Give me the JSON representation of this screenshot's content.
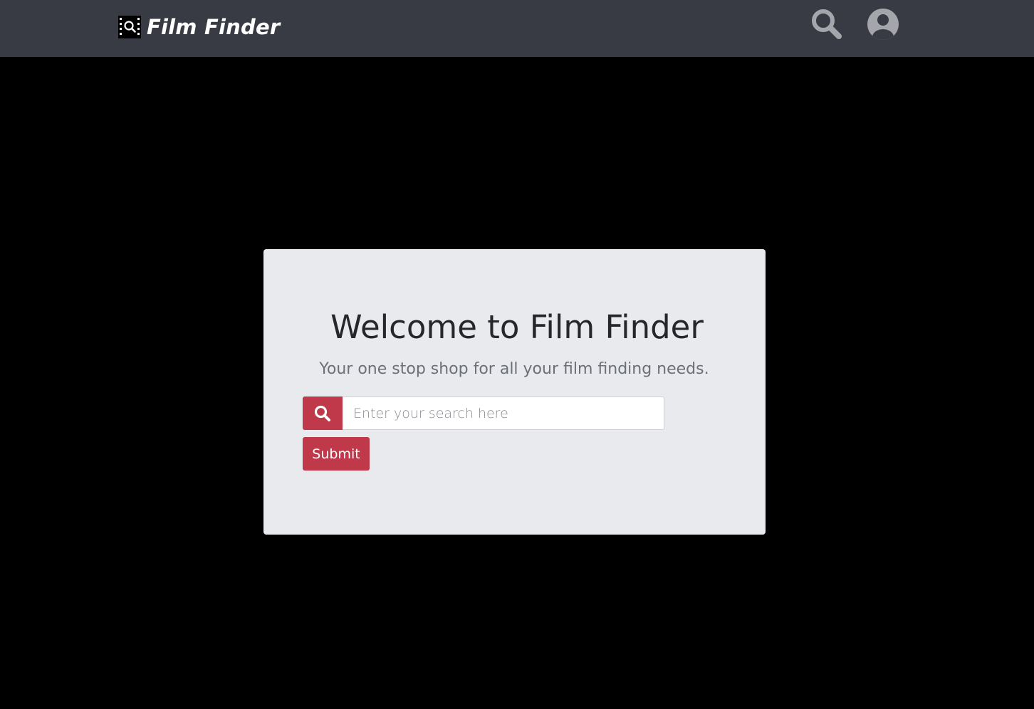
{
  "navbar": {
    "brand_text": "Film Finder",
    "logo_icon": "film-search-icon",
    "search_icon": "search-icon",
    "user_icon": "user-circle-icon",
    "background_color": "#383b43",
    "icon_color": "#a4a6ab"
  },
  "hero": {
    "title": "Welcome to Film Finder",
    "subtitle": "Your one stop shop for all your film finding needs.",
    "search_placeholder": "Enter your search here",
    "search_value": "",
    "search_button_icon": "search-icon",
    "submit_label": "Submit",
    "card_color": "#e9eaee",
    "accent_color": "#c0394a"
  }
}
